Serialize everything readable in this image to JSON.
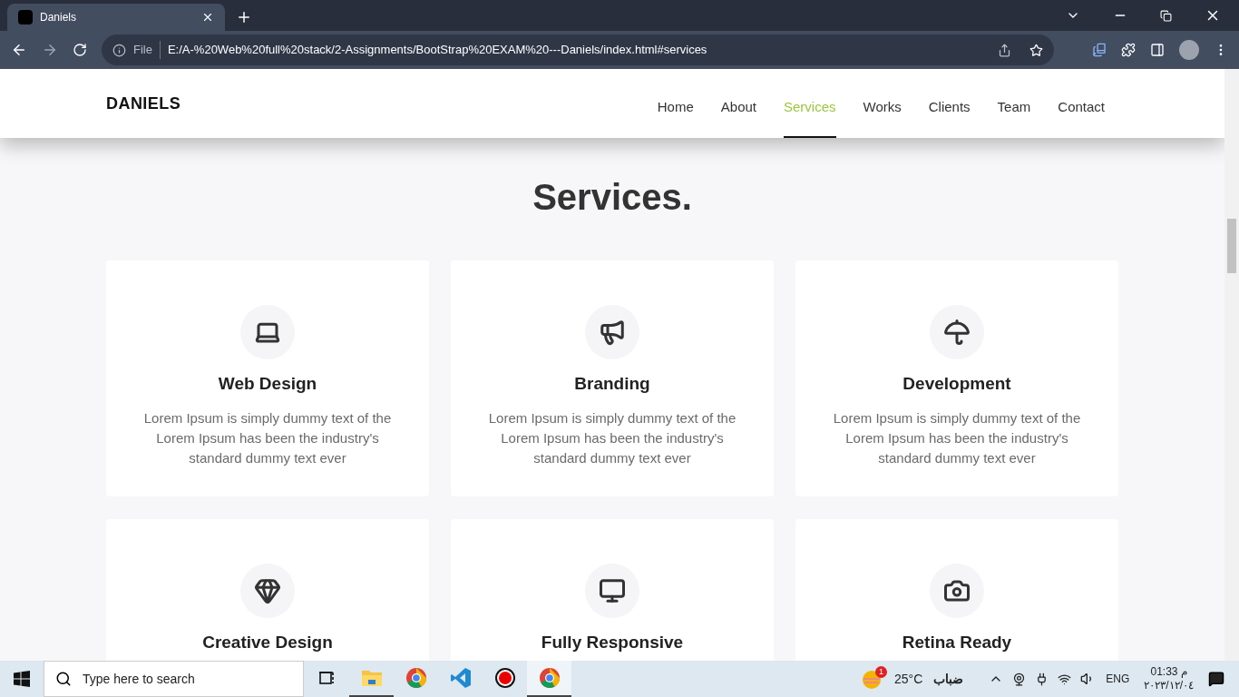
{
  "browser": {
    "tab_title": "Daniels",
    "scheme": "File",
    "url": "E:/A-%20Web%20full%20stack/2-Assignments/BootStrap%20EXAM%20---Daniels/index.html#services"
  },
  "navbar": {
    "brand": "DANIELS",
    "items": [
      {
        "label": "Home",
        "selected": false
      },
      {
        "label": "About",
        "selected": false
      },
      {
        "label": "Services",
        "selected": true
      },
      {
        "label": "Works",
        "selected": false
      },
      {
        "label": "Clients",
        "selected": false
      },
      {
        "label": "Team",
        "selected": false
      },
      {
        "label": "Contact",
        "selected": false
      }
    ]
  },
  "section": {
    "title": "Services.",
    "cards": [
      {
        "title": "Web Design",
        "text": "Lorem Ipsum is simply dummy text of the Lorem Ipsum has been the industry's standard dummy text ever"
      },
      {
        "title": "Branding",
        "text": "Lorem Ipsum is simply dummy text of the Lorem Ipsum has been the industry's standard dummy text ever"
      },
      {
        "title": "Development",
        "text": "Lorem Ipsum is simply dummy text of the Lorem Ipsum has been the industry's standard dummy text ever"
      },
      {
        "title": "Creative Design"
      },
      {
        "title": "Fully Responsive"
      },
      {
        "title": "Retina Ready"
      }
    ]
  },
  "taskbar": {
    "search_placeholder": "Type here to search",
    "apps": [
      {
        "running": false,
        "selected": false
      },
      {
        "running": true,
        "selected": false
      },
      {
        "running": false,
        "selected": false
      },
      {
        "running": false,
        "selected": false
      },
      {
        "running": false,
        "selected": false
      },
      {
        "running": true,
        "selected": true
      }
    ],
    "weather_badge": "1",
    "temperature": "25°C",
    "weather": "ضباب",
    "language": "ENG",
    "time": "01:33 م",
    "date": "٢٠٢٣/١٢/٠٤"
  }
}
